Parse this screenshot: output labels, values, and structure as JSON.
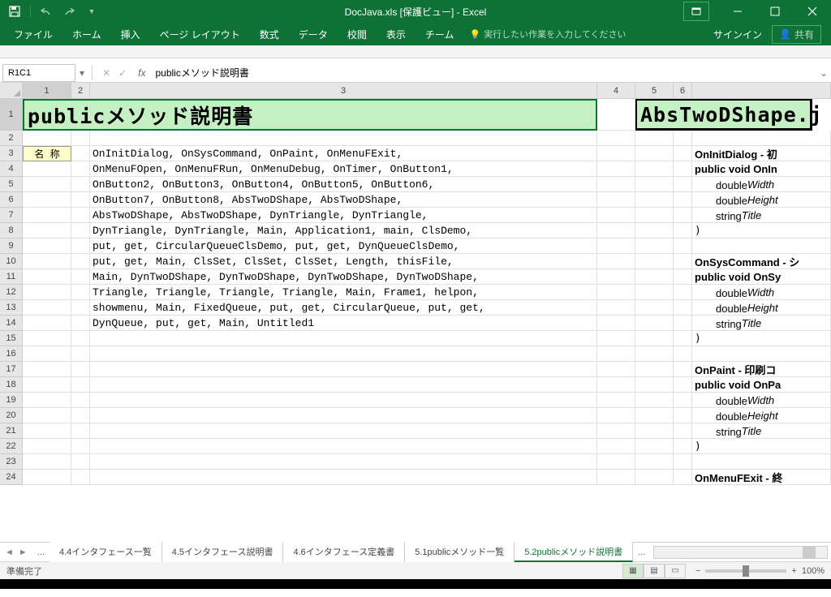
{
  "title": "DocJava.xls  [保護ビュー] - Excel",
  "ribbon": {
    "file": "ファイル",
    "home": "ホーム",
    "insert": "挿入",
    "pagelayout": "ページ レイアウト",
    "formulas": "数式",
    "data": "データ",
    "review": "校閲",
    "view": "表示",
    "team": "チーム",
    "tellme": "実行したい作業を入力してください",
    "signin": "サインイン",
    "share": "共有"
  },
  "namebox": "R1C1",
  "formula": "publicメソッド説明書",
  "colheaders": [
    "1",
    "2",
    "3",
    "4",
    "5",
    "6"
  ],
  "banner1": "publicメソッド説明書",
  "banner2": "AbsTwoDShape.j",
  "label_name": "名 称",
  "method_lines": [
    "OnInitDialog, OnSysCommand, OnPaint, OnMenuFExit,",
    "OnMenuFOpen, OnMenuFRun, OnMenuDebug, OnTimer, OnButton1,",
    "OnButton2, OnButton3, OnButton4, OnButton5, OnButton6,",
    "OnButton7, OnButton8, AbsTwoDShape, AbsTwoDShape,",
    "AbsTwoDShape, AbsTwoDShape, DynTriangle, DynTriangle,",
    "DynTriangle, DynTriangle, Main, Application1, main, ClsDemo,",
    "put, get, CircularQueueClsDemo, put, get, DynQueueClsDemo,",
    "put, get, Main, ClsSet, ClsSet, ClsSet, Length, thisFile,",
    "Main, DynTwoDShape, DynTwoDShape, DynTwoDShape, DynTwoDShape,",
    "Triangle, Triangle, Triangle, Triangle, Main, Frame1, helpon,",
    "showmenu, Main, FixedQueue, put, get, CircularQueue, put, get,",
    "DynQueue, put, get, Main, Untitled1"
  ],
  "right_blocks": [
    {
      "head": "OnInitDialog - 初",
      "sig": "public void OnIn",
      "p1": "double",
      "p1v": "Width",
      "p2": "double",
      "p2v": "Height",
      "p3": "string",
      "p3v": "Title",
      "close": ")"
    },
    {
      "head": "OnSysCommand - シ",
      "sig": "public void OnSy",
      "p1": "double",
      "p1v": "Width",
      "p2": "double",
      "p2v": "Height",
      "p3": "string",
      "p3v": "Title",
      "close": ")"
    },
    {
      "head": "OnPaint  - 印刷コ",
      "sig": "public void OnPa",
      "p1": "double",
      "p1v": "Width",
      "p2": "double",
      "p2v": "Height",
      "p3": "string",
      "p3v": "Title",
      "close": ")"
    },
    {
      "head": "OnMenuFExit - 終"
    }
  ],
  "sheet_tabs": [
    "4.4インタフェース一覧",
    "4.5インタフェース説明書",
    "4.6インタフェース定義書",
    "5.1publicメソッド一覧",
    "5.2publicメソッド説明書"
  ],
  "active_tab": 4,
  "status": "準備完了",
  "zoom": "100%"
}
